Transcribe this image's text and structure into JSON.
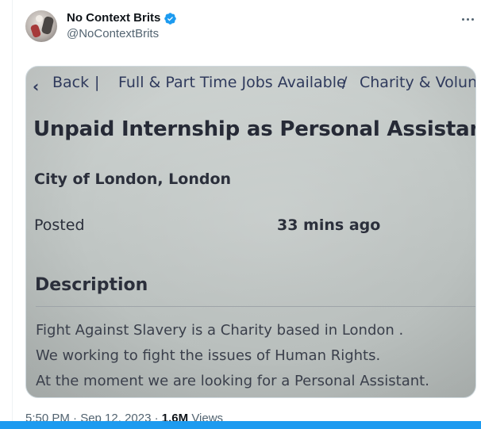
{
  "tweet": {
    "author_name": "No Context Brits",
    "author_handle": "@NoContextBrits",
    "verified_icon": "verified-badge-icon",
    "more_icon": "more-horizontal-icon",
    "timestamp": "5:50 PM · Sep 12, 2023 ·",
    "views_count": "1.6M",
    "views_label": "Views"
  },
  "photo": {
    "back_label": "Back",
    "separator_1": "|",
    "crumb_jobs": "Full & Part Time Jobs Available",
    "separator_2": "/",
    "crumb_charity": "Charity & Volunt",
    "job_title": "Unpaid Internship as Personal Assistant",
    "location": "City of London, London",
    "posted_label": "Posted",
    "posted_value": "33 mins ago",
    "description_heading": "Description",
    "description_lines": [
      "Fight Against Slavery is a Charity based in London .",
      "We working to fight the issues of Human Rights.",
      "At the moment we are looking for a Personal Assistant."
    ]
  },
  "colors": {
    "verified_blue": "#1d9bf0",
    "secondary_text": "#536471",
    "primary_text": "#0f1419"
  }
}
